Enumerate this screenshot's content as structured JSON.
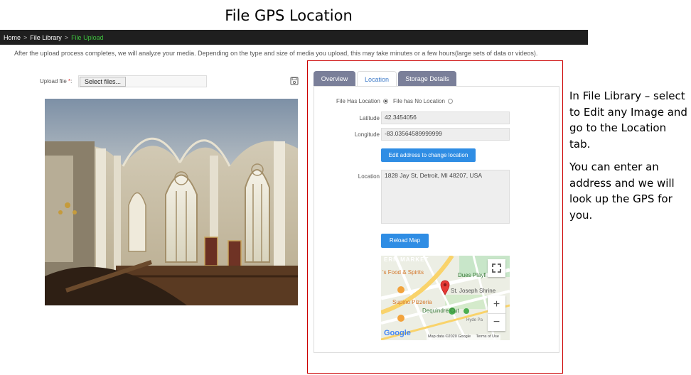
{
  "slide": {
    "title": "File GPS Location",
    "side_note_1": "In File Library – select to Edit any Image and go to the Location tab.",
    "side_note_2": "You can enter an address and we will look up the GPS for you."
  },
  "breadcrumb": {
    "home": "Home",
    "library": "File Library",
    "current": "File Upload",
    "separator": ">"
  },
  "upload": {
    "info_text": "After the upload process completes, we will analyze your media. Depending on the type and size of media you upload, this may take minutes or a few hours(large sets of data or videos).",
    "label": "Upload file",
    "required_mark": "*",
    "colon": ":",
    "button": "Select files...",
    "save_icon": "save-icon"
  },
  "tabs": [
    "Overview",
    "Location",
    "Storage Details"
  ],
  "location_form": {
    "radio_has": "File Has Location",
    "radio_none": "File has No Location",
    "selected": "File Has Location",
    "latitude_label": "Latitude",
    "latitude_value": "42.3454056",
    "longitude_label": "Longitude",
    "longitude_value": "-83.03564589999999",
    "edit_button": "Edit address to change location",
    "location_label": "Location",
    "location_value": "1828 Jay St, Detroit, MI 48207, USA",
    "reload_button": "Reload Map"
  },
  "map": {
    "labels": [
      "ERN MARKET",
      "'s Food & Spirits",
      "Dues Playfi",
      "St. Joseph Shrine",
      "Supino Pizzeria",
      "Dequindre Cut",
      "Hyde Pa"
    ],
    "logo": "Google",
    "attribution": "Map data ©2020 Google",
    "terms": "Terms of Use",
    "zoom_in": "+",
    "zoom_out": "−",
    "pin_color": "#e53935"
  },
  "colors": {
    "tab_inactive": "#7a7f99",
    "accent_blue": "#2f8de4",
    "breadcrumb_active": "#3ec13e",
    "frame_red": "#cc0000"
  }
}
